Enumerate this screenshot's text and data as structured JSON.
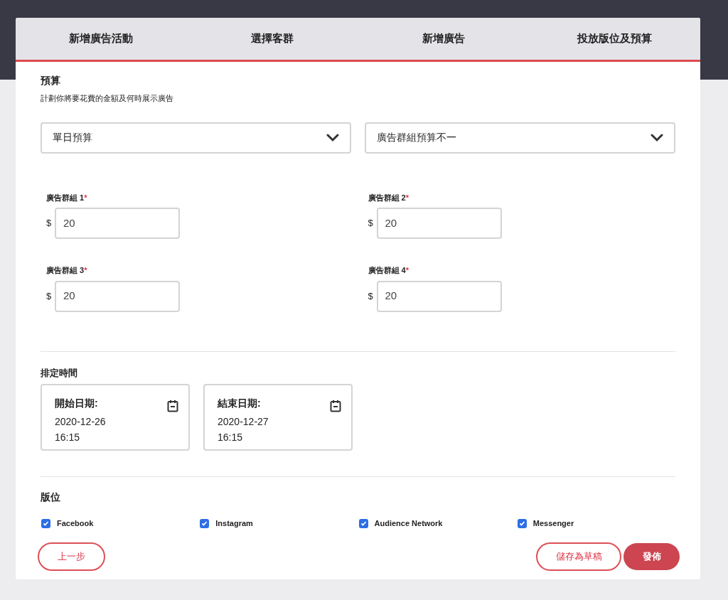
{
  "steps": [
    "新增廣告活動",
    "選擇客群",
    "新增廣告",
    "投放版位及預算"
  ],
  "budget": {
    "title": "預算",
    "description": "計劃你將要花費的金額及何時展示廣告",
    "selects": [
      {
        "value": "單日預算"
      },
      {
        "value": "廣告群組預算不一"
      }
    ],
    "groups": [
      {
        "label": "廣告群組 1",
        "marker": "*",
        "currency": "$",
        "value": "20"
      },
      {
        "label": "廣告群組 2",
        "marker": "*",
        "currency": "$",
        "value": "20"
      },
      {
        "label": "廣告群組 3",
        "marker": "*",
        "currency": "$",
        "value": "20"
      },
      {
        "label": "廣告群組 4",
        "marker": "*",
        "currency": "$",
        "value": "20"
      }
    ]
  },
  "schedule": {
    "title": "排定時間",
    "dates": [
      {
        "label": "開始日期:",
        "date": "2020-12-26",
        "time": "16:15"
      },
      {
        "label": "結束日期:",
        "date": "2020-12-27",
        "time": "16:15"
      }
    ]
  },
  "placements": {
    "title": "版位",
    "items": [
      {
        "label": "Facebook",
        "checked": true
      },
      {
        "label": "Instagram",
        "checked": true
      },
      {
        "label": "Audience Network",
        "checked": true
      },
      {
        "label": "Messenger",
        "checked": true
      }
    ]
  },
  "buttons": {
    "back": "上一步",
    "draft": "儲存為草稿",
    "publish": "發佈"
  }
}
